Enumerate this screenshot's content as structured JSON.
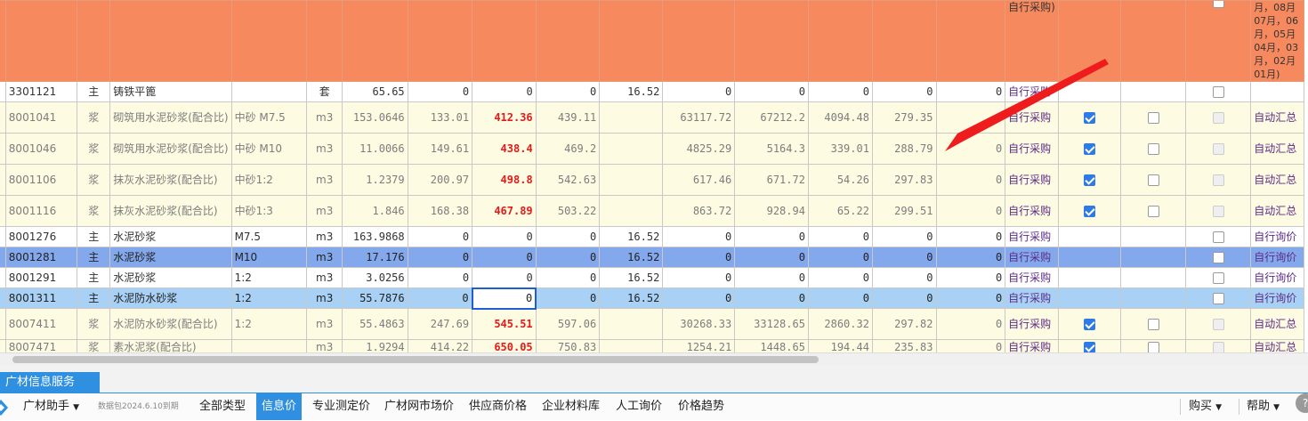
{
  "header_cells": {
    "purchase": "自行采购)",
    "note_lines": [
      "月，08月",
      "07月，06",
      "月，05月",
      "04月，03",
      "月，02月",
      "01月)"
    ]
  },
  "rows": [
    {
      "style": "r-wh",
      "code": "3301121",
      "cat": "主",
      "name": "铸铁平篦",
      "spec": "",
      "unit": "套",
      "qty": "65.65",
      "p1": "0",
      "p2": "0",
      "p3": "0",
      "p4": "16.52",
      "a1": "0",
      "a2": "0",
      "a3": "0",
      "a4": "0",
      "a5": "0",
      "mode": "自行采购",
      "c1": "",
      "c2": "",
      "c3": "empty",
      "last": ""
    },
    {
      "style": "r-ye",
      "code": "8001041",
      "cat": "浆",
      "name": "砌筑用水泥砂浆(配合比)",
      "spec": "中砂 M7.5",
      "unit": "m3",
      "qty": "153.0646",
      "p1": "133.01",
      "p2": "412.36",
      "p3": "439.11",
      "p4": "",
      "a1": "63117.72",
      "a2": "67212.2",
      "a3": "4094.48",
      "a4": "279.35",
      "a5": "0",
      "mode": "自行采购",
      "c1": "on",
      "c2": "empty",
      "c3": "dis",
      "last": "自动汇总"
    },
    {
      "style": "r-ye",
      "code": "8001046",
      "cat": "浆",
      "name": "砌筑用水泥砂浆(配合比)",
      "spec": "中砂 M10",
      "unit": "m3",
      "qty": "11.0066",
      "p1": "149.61",
      "p2": "438.4",
      "p3": "469.2",
      "p4": "",
      "a1": "4825.29",
      "a2": "5164.3",
      "a3": "339.01",
      "a4": "288.79",
      "a5": "0",
      "mode": "自行采购",
      "c1": "on",
      "c2": "empty",
      "c3": "dis",
      "last": "自动汇总"
    },
    {
      "style": "r-ye",
      "code": "8001106",
      "cat": "浆",
      "name": "抹灰水泥砂浆(配合比)",
      "spec": "中砂1:2",
      "unit": "m3",
      "qty": "1.2379",
      "p1": "200.97",
      "p2": "498.8",
      "p3": "542.63",
      "p4": "",
      "a1": "617.46",
      "a2": "671.72",
      "a3": "54.26",
      "a4": "297.83",
      "a5": "0",
      "mode": "自行采购",
      "c1": "on",
      "c2": "empty",
      "c3": "dis",
      "last": "自动汇总"
    },
    {
      "style": "r-ye",
      "code": "8001116",
      "cat": "浆",
      "name": "抹灰水泥砂浆(配合比)",
      "spec": "中砂1:3",
      "unit": "m3",
      "qty": "1.846",
      "p1": "168.38",
      "p2": "467.89",
      "p3": "503.22",
      "p4": "",
      "a1": "863.72",
      "a2": "928.94",
      "a3": "65.22",
      "a4": "299.51",
      "a5": "0",
      "mode": "自行采购",
      "c1": "on",
      "c2": "empty",
      "c3": "dis",
      "last": "自动汇总"
    },
    {
      "style": "r-wh",
      "code": "8001276",
      "cat": "主",
      "name": "水泥砂浆",
      "spec": "M7.5",
      "unit": "m3",
      "qty": "163.9868",
      "p1": "0",
      "p2": "0",
      "p3": "0",
      "p4": "16.52",
      "a1": "0",
      "a2": "0",
      "a3": "0",
      "a4": "0",
      "a5": "0",
      "mode": "自行采购",
      "c1": "",
      "c2": "",
      "c3": "empty",
      "last": "自行询价"
    },
    {
      "style": "r-blue",
      "code": "8001281",
      "cat": "主",
      "name": "水泥砂浆",
      "spec": "M10",
      "unit": "m3",
      "qty": "17.176",
      "p1": "0",
      "p2": "0",
      "p3": "0",
      "p4": "16.52",
      "a1": "0",
      "a2": "0",
      "a3": "0",
      "a4": "0",
      "a5": "0",
      "mode": "自行采购",
      "c1": "",
      "c2": "",
      "c3": "empty",
      "last": "自行询价"
    },
    {
      "style": "r-wh",
      "code": "8001291",
      "cat": "主",
      "name": "水泥砂浆",
      "spec": "1:2",
      "unit": "m3",
      "qty": "3.0256",
      "p1": "0",
      "p2": "0",
      "p3": "0",
      "p4": "16.52",
      "a1": "0",
      "a2": "0",
      "a3": "0",
      "a4": "0",
      "a5": "0",
      "mode": "自行采购",
      "c1": "",
      "c2": "",
      "c3": "empty",
      "last": "自行询价"
    },
    {
      "style": "r-lb",
      "code": "8001311",
      "cat": "主",
      "name": "水泥防水砂浆",
      "spec": "1:2",
      "unit": "m3",
      "qty": "55.7876",
      "p1": "0",
      "p2": "0",
      "p3": "0",
      "p4": "16.52",
      "a1": "0",
      "a2": "0",
      "a3": "0",
      "a4": "0",
      "a5": "0",
      "mode": "自行采购",
      "c1": "",
      "c2": "",
      "c3": "empty",
      "last": "自行询价"
    },
    {
      "style": "r-ye",
      "code": "8007411",
      "cat": "浆",
      "name": "水泥防水砂浆(配合比)",
      "spec": "1:2",
      "unit": "m3",
      "qty": "55.4863",
      "p1": "247.69",
      "p2": "545.51",
      "p3": "597.06",
      "p4": "",
      "a1": "30268.33",
      "a2": "33128.65",
      "a3": "2860.32",
      "a4": "297.82",
      "a5": "0",
      "mode": "自行采购",
      "c1": "on",
      "c2": "empty",
      "c3": "dis",
      "last": "自动汇总"
    },
    {
      "style": "r-ye",
      "code": "8007471",
      "cat": "浆",
      "name": "素水泥浆(配合比)",
      "spec": "",
      "unit": "m3",
      "qty": "1.9294",
      "p1": "414.22",
      "p2": "650.05",
      "p3": "750.83",
      "p4": "",
      "a1": "1254.21",
      "a2": "1448.65",
      "a3": "194.44",
      "a4": "235.83",
      "a5": "0",
      "mode": "自行采购",
      "c1": "on",
      "c2": "empty",
      "c3": "dis",
      "last": "自动汇总"
    }
  ],
  "panel": {
    "service_tab": "广材信息服务"
  },
  "toolbar": {
    "assistant": "广材助手",
    "expire": "数据包2024.6.10到期",
    "all_types": "全部类型",
    "info_price": "信息价",
    "professional": "专业测定价",
    "market": "广材网市场价",
    "supplier": "供应商价格",
    "enterprise": "企业材料库",
    "manual": "人工询价",
    "trend": "价格趋势",
    "buy": "购买",
    "help": "帮助"
  },
  "icons": {
    "dropdown": "chevron-down-icon",
    "logo": "guangcai-logo-icon"
  },
  "colors": {
    "header_bg": "#f6895e",
    "accent": "#2f8fe0",
    "red_price": "#e21b1b",
    "row_yellow": "#fdfbe2",
    "row_selected": "#84a8ec",
    "row_light_blue": "#a8d1f5"
  }
}
